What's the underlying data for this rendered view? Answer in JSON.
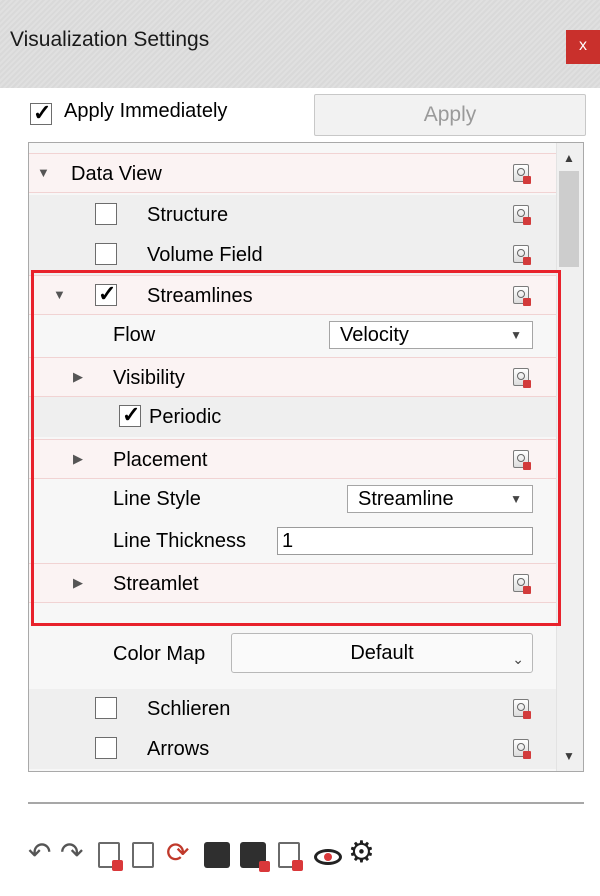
{
  "window": {
    "title": "Visualization Settings",
    "close_label": "x"
  },
  "apply": {
    "checkbox_label": "Apply Immediately",
    "checked_mark": "✓",
    "button_label": "Apply"
  },
  "tree": {
    "data_view": "Data View",
    "structure": "Structure",
    "volume_field": "Volume Field",
    "streamlines": "Streamlines",
    "flow_label": "Flow",
    "flow_value": "Velocity",
    "visibility": "Visibility",
    "periodic": "Periodic",
    "placement": "Placement",
    "line_style_label": "Line Style",
    "line_style_value": "Streamline",
    "line_thickness_label": "Line Thickness",
    "line_thickness_value": "1",
    "streamlet": "Streamlet",
    "color_map_label": "Color Map",
    "color_map_value": "Default",
    "schlieren": "Schlieren",
    "arrows": "Arrows"
  },
  "glyphs": {
    "expanded": "▼",
    "collapsed": "▶",
    "check": "✓",
    "dropdown": "▼",
    "dropdown_small": "⌄",
    "scroll_up": "▲",
    "scroll_down": "▼",
    "undo": "↶",
    "redo": "↷",
    "sync": "⟳",
    "gear": "⚙"
  },
  "colors": {
    "highlight": "#e8212b",
    "close_button": "#c9302c",
    "accent_red": "#d9383a"
  },
  "toolbar_icons": [
    "undo-icon",
    "redo-icon",
    "lock-doc-icon",
    "doc-sync-icon",
    "sync-icon",
    "dark-gear-icon",
    "dark-lock-icon",
    "code-doc-icon",
    "eye-icon",
    "gear-icon"
  ]
}
